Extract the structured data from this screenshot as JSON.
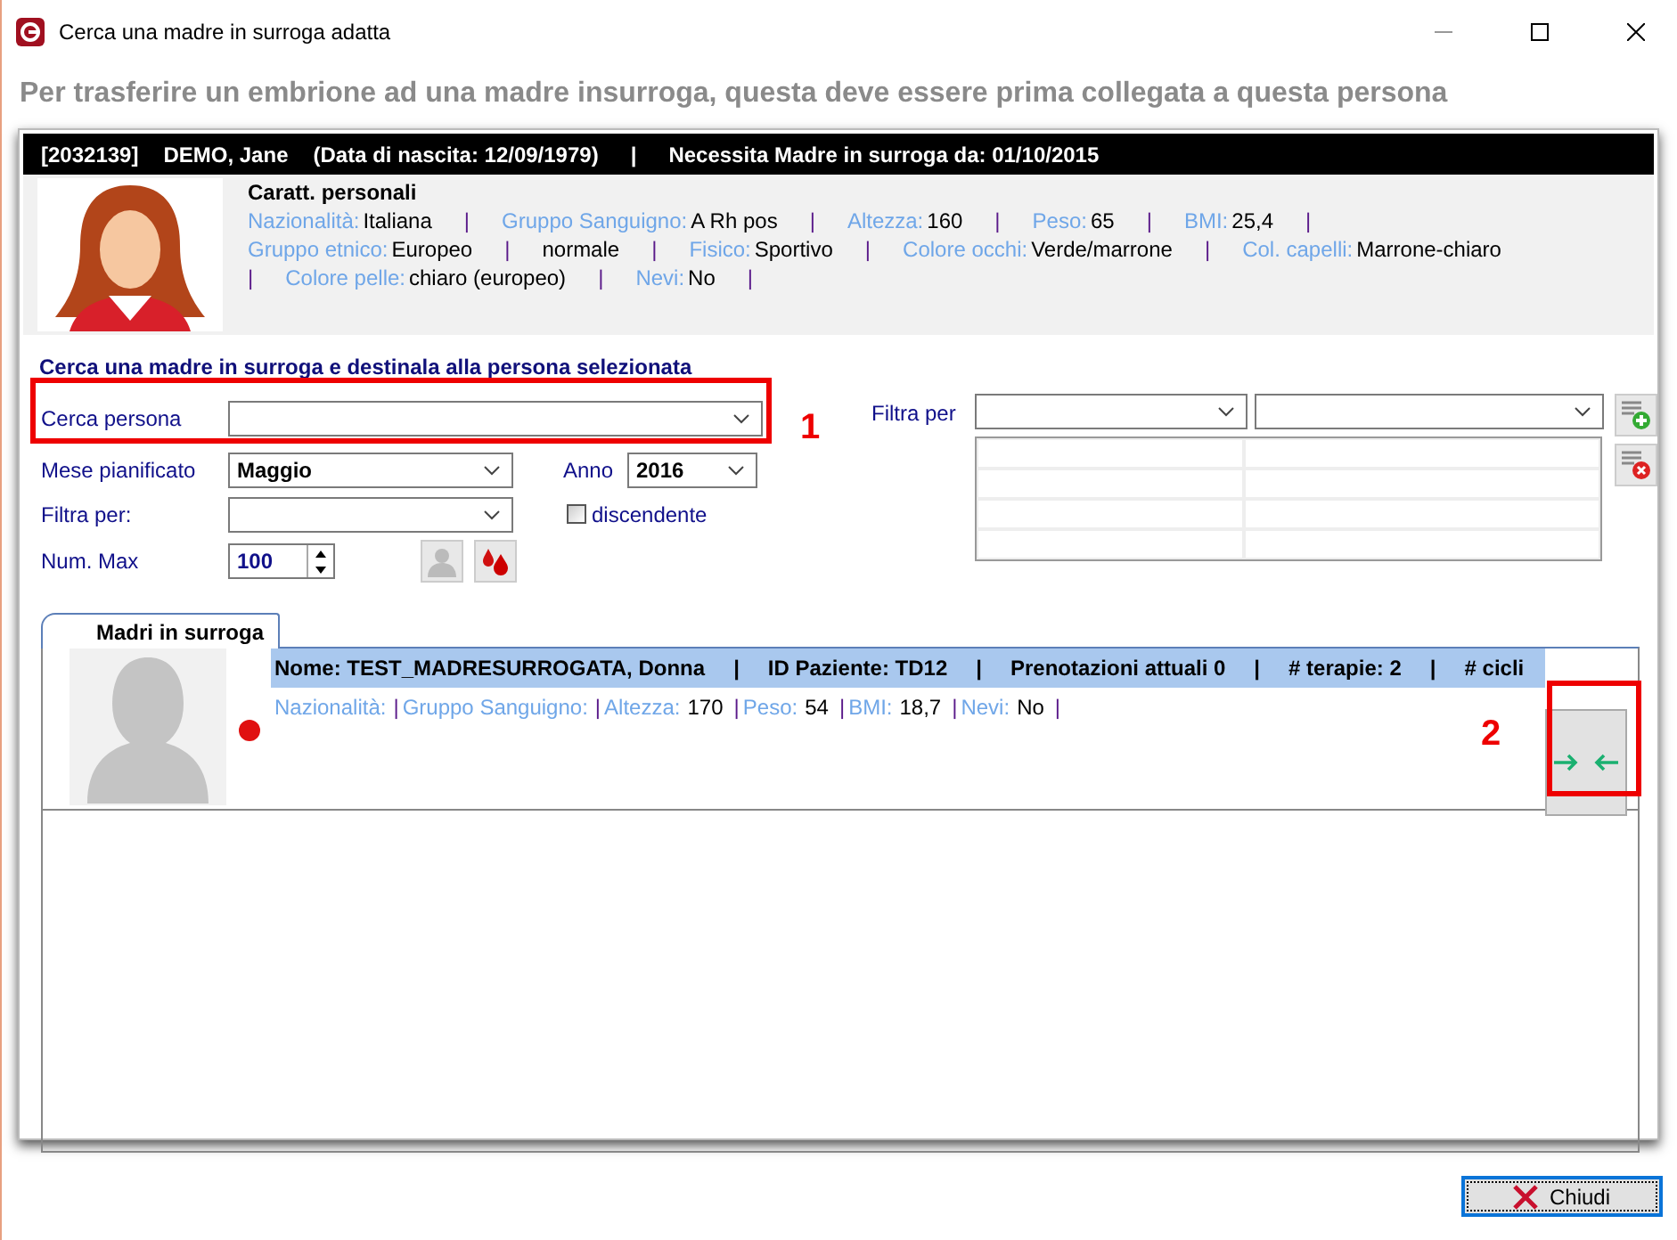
{
  "window": {
    "title": "Cerca una madre in surroga adatta"
  },
  "instruction": "Per trasferire un embrione ad una madre insurroga, questa deve essere prima collegata a questa persona",
  "patient_header": [
    "[2032139]",
    "DEMO, Jane",
    "(Data di nascita:  12/09/1979)",
    "|",
    "Necessita Madre in surroga  da:   01/10/2015"
  ],
  "personal": {
    "title": "Caratt. personali",
    "lines": [
      [
        {
          "kind": "label",
          "text": "Nazionalità:"
        },
        {
          "kind": "value",
          "text": "Italiana"
        },
        {
          "kind": "sep",
          "text": "|"
        },
        {
          "kind": "label",
          "text": "Gruppo Sanguigno:"
        },
        {
          "kind": "value",
          "text": "A Rh pos"
        },
        {
          "kind": "sep",
          "text": "|"
        },
        {
          "kind": "label",
          "text": "Altezza:"
        },
        {
          "kind": "value",
          "text": "160"
        },
        {
          "kind": "sep",
          "text": "|"
        },
        {
          "kind": "label",
          "text": "Peso:"
        },
        {
          "kind": "value",
          "text": "65"
        },
        {
          "kind": "sep",
          "text": "|"
        },
        {
          "kind": "label",
          "text": "BMI:"
        },
        {
          "kind": "value",
          "text": "25,4"
        },
        {
          "kind": "sep",
          "text": "|"
        }
      ],
      [
        {
          "kind": "label",
          "text": "Gruppo etnico:"
        },
        {
          "kind": "value",
          "text": "Europeo"
        },
        {
          "kind": "sep",
          "text": "|"
        },
        {
          "kind": "value",
          "text": "normale"
        },
        {
          "kind": "sep",
          "text": "|"
        },
        {
          "kind": "label",
          "text": "Fisico:"
        },
        {
          "kind": "value",
          "text": "Sportivo"
        },
        {
          "kind": "sep",
          "text": "|"
        },
        {
          "kind": "label",
          "text": "Colore occhi:"
        },
        {
          "kind": "value",
          "text": "Verde/marrone"
        },
        {
          "kind": "sep",
          "text": "|"
        },
        {
          "kind": "label",
          "text": "Col. capelli:"
        },
        {
          "kind": "value",
          "text": "Marrone-chiaro"
        }
      ],
      [
        {
          "kind": "sep",
          "text": "|"
        },
        {
          "kind": "label",
          "text": "Colore pelle:"
        },
        {
          "kind": "value",
          "text": "chiaro (europeo)"
        },
        {
          "kind": "sep",
          "text": "|"
        },
        {
          "kind": "label",
          "text": "Nevi:"
        },
        {
          "kind": "value",
          "text": "No"
        },
        {
          "kind": "sep",
          "text": "|"
        }
      ]
    ]
  },
  "search": {
    "title": "Cerca una madre in surroga e destinala alla persona selezionata",
    "person": {
      "label": "Cerca persona"
    },
    "month": {
      "label": "Mese pianificato",
      "value": "Maggio"
    },
    "year": {
      "label": "Anno",
      "value": "2016"
    },
    "filter": {
      "label": "Filtra per:"
    },
    "descending": {
      "label": "discendente",
      "checked": false
    },
    "max": {
      "label": "Num. Max",
      "value": "100"
    }
  },
  "filters": {
    "label": "Filtra per"
  },
  "annotations": [
    "1",
    "2"
  ],
  "tabs": [
    {
      "label": "Madri in surroga",
      "selected": true
    }
  ],
  "results": [
    {
      "color": "#e01010",
      "header": [
        "Nome:  TEST_MADRESURROGATA, Donna",
        "|",
        "ID Paziente:  TD12",
        "|",
        "Prenotazioni attuali  0",
        "|",
        "# terapie:  2",
        "|",
        "# cicli"
      ],
      "details": [
        {
          "kind": "label",
          "text": "Nazionalità:"
        },
        {
          "kind": "sep",
          "text": "|"
        },
        {
          "kind": "label",
          "text": "Gruppo Sanguigno:"
        },
        {
          "kind": "sep",
          "text": "|"
        },
        {
          "kind": "label",
          "text": "Altezza:"
        },
        {
          "kind": "value",
          "text": "170"
        },
        {
          "kind": "sep",
          "text": "|"
        },
        {
          "kind": "label",
          "text": "Peso:"
        },
        {
          "kind": "value",
          "text": "54"
        },
        {
          "kind": "sep",
          "text": "|"
        },
        {
          "kind": "label",
          "text": "BMI:"
        },
        {
          "kind": "value",
          "text": "18,7"
        },
        {
          "kind": "sep",
          "text": "|"
        },
        {
          "kind": "label",
          "text": "Nevi:"
        },
        {
          "kind": "value",
          "text": "No"
        },
        {
          "kind": "sep",
          "text": "|"
        }
      ]
    }
  ],
  "close_button": "Chiudi"
}
